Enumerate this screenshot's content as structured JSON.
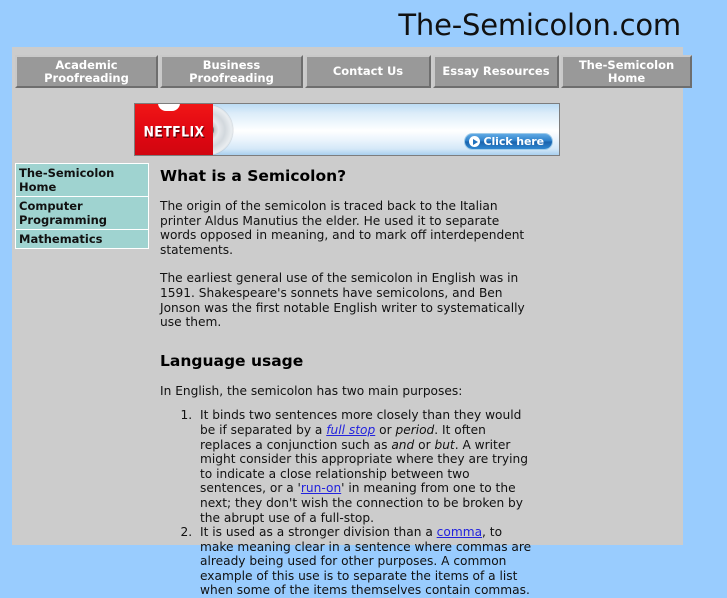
{
  "site": {
    "title": "The-Semicolon.com",
    "background_color": "#99ccfe",
    "panel_color": "#cccccc"
  },
  "nav": {
    "tabs": [
      {
        "line1": "Academic",
        "line2": "Proofreading"
      },
      {
        "line1": "Business",
        "line2": "Proofreading"
      },
      {
        "line1": "Contact Us",
        "line2": ""
      },
      {
        "line1": "Essay Resources",
        "line2": ""
      },
      {
        "line1": "The-Semicolon",
        "line2": "Home"
      }
    ]
  },
  "banner": {
    "brand": "NETFLIX",
    "cta_label": "Click here",
    "cta_icon": "play-circle-icon",
    "disc_icon": "dvd-disc-icon"
  },
  "sidebar": {
    "items": [
      {
        "label": "The-Semicolon Home"
      },
      {
        "label": "Computer Programming"
      },
      {
        "label": "Mathematics"
      }
    ]
  },
  "article": {
    "heading1": "What is a Semicolon?",
    "paragraph1": "The origin of the semicolon is traced back to the Italian printer Aldus Manutius the elder. He used it to separate words opposed in meaning, and to mark off interdependent statements.",
    "paragraph2": "The earliest general use of the semicolon in English was in 1591. Shakespeare's sonnets have semicolons, and Ben Jonson was the first notable English writer to systematically use them.",
    "heading2": "Language usage",
    "paragraph3": "In English, the semicolon has two main purposes:",
    "list": [
      {
        "part1": "It binds two sentences more closely than they would be if separated by a ",
        "link1": "full stop",
        "part2": " or ",
        "em1": "period",
        "part3": ". It often replaces a conjunction such as ",
        "em2": "and",
        "part4": " or ",
        "em3": "but",
        "part5": ". A writer might consider this appropriate where they are trying to indicate a close relationship between two sentences, or a '",
        "link2": "run-on",
        "part6": "' in meaning from one to the next; they don't wish the connection to be broken by the abrupt use of a full-stop."
      },
      {
        "part1": "It is used as a stronger division than a ",
        "link1": "comma",
        "part2": ", to make meaning clear in a sentence where commas are already being used for other purposes. A common example of this use is to separate the items of a list when some of the items themselves contain commas."
      }
    ]
  },
  "colors": {
    "link": "#2222dd",
    "sidebar_item": "#9fd3d0",
    "nav_tab": "#999999",
    "netflix_red": "#e50914"
  }
}
